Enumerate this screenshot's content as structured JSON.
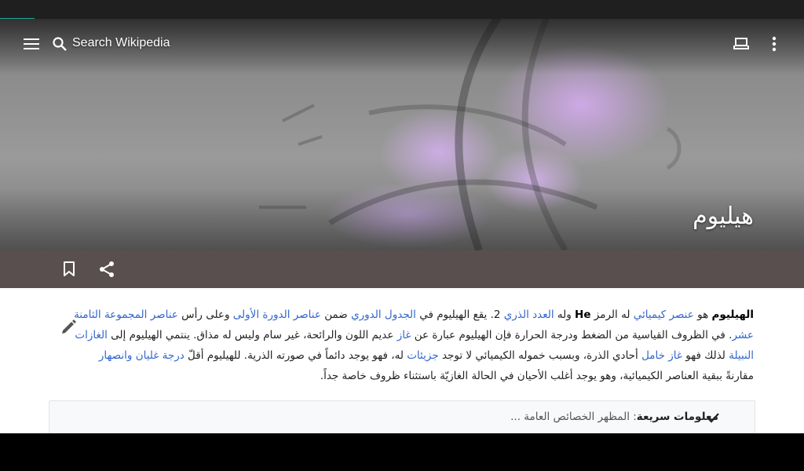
{
  "toolbar": {
    "search_placeholder": "Search Wikipedia",
    "menu_icon": "hamburger-menu-icon",
    "search_icon": "search-icon",
    "tabs_icon": "tabs-icon",
    "overflow_icon": "more-vert-icon"
  },
  "article": {
    "title": "هيليوم",
    "lead": {
      "p1": "الهيليوم",
      "p2": " هو ",
      "l_element": "عنصر كيميائي",
      "p3": " له الرمز ",
      "symbol": "He",
      "p4": " وله ",
      "l_atomic_number": "العدد الذري",
      "p5": " 2. يقع الهيليوم في ",
      "l_periodic_table": "الجدول الدوري",
      "p6": " ضمن ",
      "l_period1": "عناصر الدورة الأولى",
      "p7": " وعلى رأس ",
      "l_group18": "عناصر المجموعة الثامنة عشر",
      "p8": ". في الظروف القياسية من الضغط ودرجة الحرارة فإن الهيليوم عبارة عن ",
      "l_gas": "غاز",
      "p9": " عديم اللون والرائحة، غير سام وليس له مذاق. ينتمي الهيليوم إلى ",
      "l_noble_gases": "الغازات النبيلة",
      "p10": " لذلك فهو ",
      "l_inert_gas": "غاز خامل",
      "p11": " أحادي الذرة، وبسبب خموله الكيميائي لا توجد ",
      "l_molecules": "جزيئات",
      "p12": " له، فهو يوجد دائماً في صورته الذرية. للهيليوم أقلّ ",
      "l_boiling": "درجة غليان",
      "p13": " ",
      "l_melting": "وانصهار",
      "p14": " مقارنةً ببقية العناصر الكيميائية، وهو يوجد أغلب الأحيان في الحالة الغازيّة باستثناء ظروف خاصة جداً."
    }
  },
  "quick_facts": {
    "title": "معلومات سريعة",
    "summary": ": المظهر الخصائص العامة ..."
  },
  "actions": {
    "bookmark_icon": "bookmark-icon",
    "share_icon": "share-icon",
    "edit_icon": "pencil-icon"
  },
  "colors": {
    "accent": "#1fa595",
    "action_bar": "#5a4f4f",
    "link": "#3366cc"
  }
}
